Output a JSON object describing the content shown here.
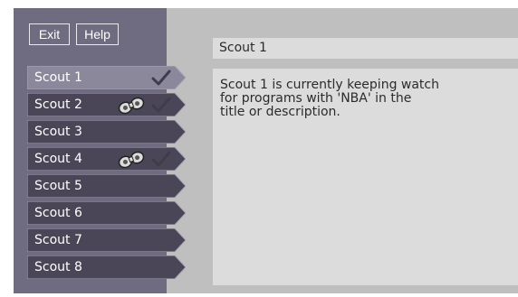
{
  "toolbar": {
    "exit_label": "Exit",
    "help_label": "Help"
  },
  "scouts": [
    {
      "label": "Scout 1",
      "selected": true,
      "binoculars": false,
      "check": true
    },
    {
      "label": "Scout 2",
      "selected": false,
      "binoculars": true,
      "check": true
    },
    {
      "label": "Scout 3",
      "selected": false,
      "binoculars": false,
      "check": false
    },
    {
      "label": "Scout 4",
      "selected": false,
      "binoculars": true,
      "check": true
    },
    {
      "label": "Scout 5",
      "selected": false,
      "binoculars": false,
      "check": false
    },
    {
      "label": "Scout 6",
      "selected": false,
      "binoculars": false,
      "check": false
    },
    {
      "label": "Scout 7",
      "selected": false,
      "binoculars": false,
      "check": false
    },
    {
      "label": "Scout 8",
      "selected": false,
      "binoculars": false,
      "check": false
    }
  ],
  "detail": {
    "title": "Scout 1",
    "description_lines": [
      "Scout 1 is currently keeping watch",
      "for programs with 'NBA' in the",
      "title or description."
    ]
  },
  "colors": {
    "panel": "#6f6c82",
    "right_panel": "#bfbfbf",
    "tab_normal": "#4a4657",
    "tab_selected": "#8c889c",
    "check": "#3f3d4a",
    "box": "#dcdcdc"
  },
  "icons": {
    "binoculars": "binoculars-icon",
    "check": "checkmark-icon"
  }
}
